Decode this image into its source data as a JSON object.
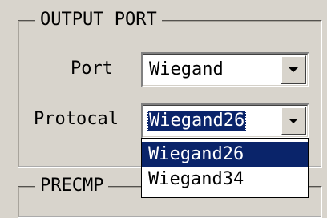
{
  "output_port": {
    "title": "OUTPUT PORT",
    "port_label": "Port",
    "port_value": "Wiegand",
    "protocol_label": "Protocal",
    "protocol_value": "Wiegand26",
    "protocol_options": [
      "Wiegand26",
      "Wiegand34"
    ],
    "selected_option_index": 0
  },
  "precmp": {
    "title": "PRECMP"
  },
  "icons": {
    "dropdown_arrow": "chevron-down-icon"
  },
  "colors": {
    "background": "#d8d4cc",
    "selection": "#0a246a",
    "selection_text": "#ffffff"
  }
}
